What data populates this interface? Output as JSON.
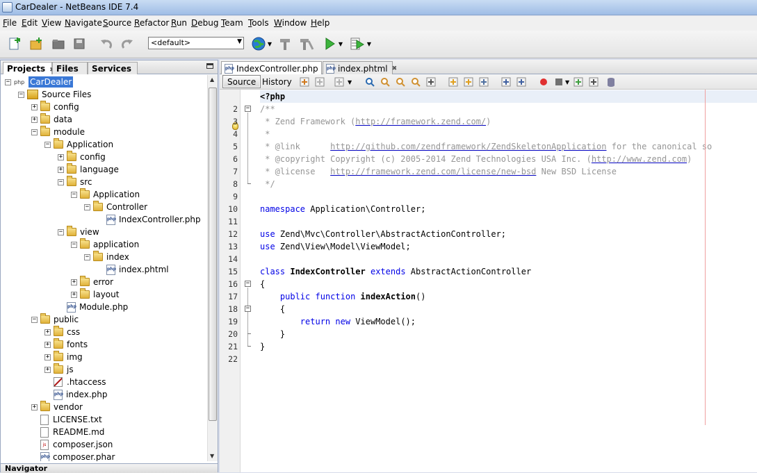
{
  "window": {
    "title": "CarDealer - NetBeans IDE 7.4"
  },
  "menu": [
    "File",
    "Edit",
    "View",
    "Navigate",
    "Source",
    "Refactor",
    "Run",
    "Debug",
    "Team",
    "Tools",
    "Window",
    "Help"
  ],
  "toolbar": {
    "config_value": "<default>"
  },
  "left_panel": {
    "tabs": [
      {
        "label": "Projects"
      },
      {
        "label": "Files"
      },
      {
        "label": "Services"
      }
    ],
    "tree": [
      {
        "label": "CarDealer",
        "indent": 0,
        "kind": "project",
        "exp": "-",
        "selected": true
      },
      {
        "label": "Source Files",
        "indent": 1,
        "kind": "pkg",
        "exp": "-"
      },
      {
        "label": "config",
        "indent": 2,
        "kind": "folder",
        "exp": "+"
      },
      {
        "label": "data",
        "indent": 2,
        "kind": "folder",
        "exp": "+"
      },
      {
        "label": "module",
        "indent": 2,
        "kind": "folder",
        "exp": "-"
      },
      {
        "label": "Application",
        "indent": 3,
        "kind": "folder",
        "exp": "-"
      },
      {
        "label": "config",
        "indent": 4,
        "kind": "folder",
        "exp": "+"
      },
      {
        "label": "language",
        "indent": 4,
        "kind": "folder",
        "exp": "+"
      },
      {
        "label": "src",
        "indent": 4,
        "kind": "folder",
        "exp": "-"
      },
      {
        "label": "Application",
        "indent": 5,
        "kind": "folder",
        "exp": "-"
      },
      {
        "label": "Controller",
        "indent": 6,
        "kind": "folder",
        "exp": "-"
      },
      {
        "label": "IndexController.php",
        "indent": 7,
        "kind": "php",
        "exp": ""
      },
      {
        "label": "view",
        "indent": 4,
        "kind": "folder",
        "exp": "-"
      },
      {
        "label": "application",
        "indent": 5,
        "kind": "folder",
        "exp": "-"
      },
      {
        "label": "index",
        "indent": 6,
        "kind": "folder",
        "exp": "-"
      },
      {
        "label": "index.phtml",
        "indent": 7,
        "kind": "php",
        "exp": ""
      },
      {
        "label": "error",
        "indent": 5,
        "kind": "folder",
        "exp": "+"
      },
      {
        "label": "layout",
        "indent": 5,
        "kind": "folder",
        "exp": "+"
      },
      {
        "label": "Module.php",
        "indent": 4,
        "kind": "php",
        "exp": ""
      },
      {
        "label": "public",
        "indent": 2,
        "kind": "folder",
        "exp": "-"
      },
      {
        "label": "css",
        "indent": 3,
        "kind": "folder",
        "exp": "+"
      },
      {
        "label": "fonts",
        "indent": 3,
        "kind": "folder",
        "exp": "+"
      },
      {
        "label": "img",
        "indent": 3,
        "kind": "folder",
        "exp": "+"
      },
      {
        "label": "js",
        "indent": 3,
        "kind": "folder",
        "exp": "+"
      },
      {
        "label": ".htaccess",
        "indent": 3,
        "kind": "ht",
        "exp": ""
      },
      {
        "label": "index.php",
        "indent": 3,
        "kind": "php",
        "exp": ""
      },
      {
        "label": "vendor",
        "indent": 2,
        "kind": "folder",
        "exp": "+"
      },
      {
        "label": "LICENSE.txt",
        "indent": 2,
        "kind": "txt",
        "exp": ""
      },
      {
        "label": "README.md",
        "indent": 2,
        "kind": "txt",
        "exp": ""
      },
      {
        "label": "composer.json",
        "indent": 2,
        "kind": "json",
        "exp": ""
      },
      {
        "label": "composer.phar",
        "indent": 2,
        "kind": "php",
        "exp": ""
      }
    ],
    "navigator_label": "Navigator"
  },
  "editor": {
    "tabs": [
      {
        "label": "IndexController.php",
        "active": true
      },
      {
        "label": "index.phtml",
        "active": false
      }
    ],
    "source_label": "Source",
    "history_label": "History",
    "lines": [
      "<?php",
      "/**",
      " * Zend Framework (http://framework.zend.com/)",
      " *",
      " * @link      http://github.com/zendframework/ZendSkeletonApplication for the canonical so",
      " * @copyright Copyright (c) 2005-2014 Zend Technologies USA Inc. (http://www.zend.com)",
      " * @license   http://framework.zend.com/license/new-bsd New BSD License",
      " */",
      "",
      "namespace Application\\Controller;",
      "",
      "use Zend\\Mvc\\Controller\\AbstractActionController;",
      "use Zend\\View\\Model\\ViewModel;",
      "",
      "class IndexController extends AbstractActionController",
      "{",
      "    public function indexAction()",
      "    {",
      "        return new ViewModel();",
      "    }",
      "}",
      ""
    ]
  }
}
